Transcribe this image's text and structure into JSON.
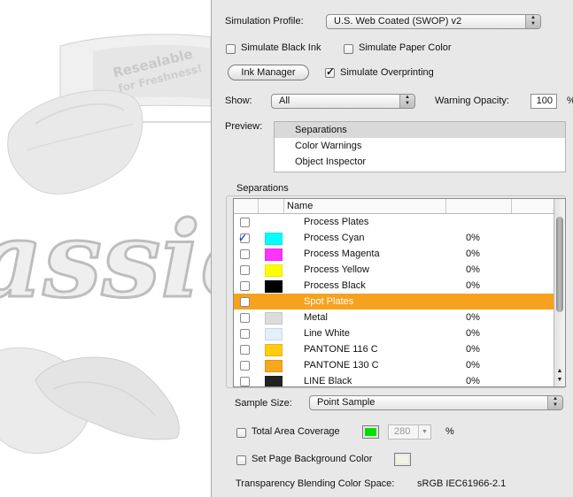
{
  "artwork": {
    "logo_text": "assic",
    "banner_text_line1": "Resealable",
    "banner_text_line2": "for Freshness!"
  },
  "panel": {
    "simulation_profile": {
      "label": "Simulation Profile:",
      "value": "U.S. Web Coated (SWOP) v2"
    },
    "simulate_black_ink": {
      "label": "Simulate Black Ink",
      "checked": false
    },
    "simulate_paper_color": {
      "label": "Simulate Paper Color",
      "checked": false
    },
    "ink_manager_label": "Ink Manager",
    "simulate_overprinting": {
      "label": "Simulate Overprinting",
      "checked": true
    },
    "show": {
      "label": "Show:",
      "value": "All"
    },
    "warning_opacity": {
      "label": "Warning Opacity:",
      "value": "100",
      "unit": "%"
    },
    "preview": {
      "label": "Preview:",
      "items": [
        "Separations",
        "Color Warnings",
        "Object Inspector"
      ],
      "selected": "Separations"
    },
    "separations": {
      "label": "Separations",
      "header_name": "Name",
      "rows": [
        {
          "name": "Process Plates",
          "pct": "",
          "checked": false,
          "swatch": "",
          "selected": false
        },
        {
          "name": "Process Cyan",
          "pct": "0%",
          "checked": true,
          "swatch": "#00ffff",
          "selected": false
        },
        {
          "name": "Process Magenta",
          "pct": "0%",
          "checked": false,
          "swatch": "#ff33ff",
          "selected": false
        },
        {
          "name": "Process Yellow",
          "pct": "0%",
          "checked": false,
          "swatch": "#ffff00",
          "selected": false
        },
        {
          "name": "Process Black",
          "pct": "0%",
          "checked": false,
          "swatch": "#000000",
          "selected": false
        },
        {
          "name": "Spot Plates",
          "pct": "",
          "checked": false,
          "swatch": "",
          "selected": true
        },
        {
          "name": "Metal",
          "pct": "0%",
          "checked": false,
          "swatch": "#dcdcdc",
          "selected": false
        },
        {
          "name": "Line White",
          "pct": "0%",
          "checked": false,
          "swatch": "#e3f0f9",
          "selected": false
        },
        {
          "name": "PANTONE 116 C",
          "pct": "0%",
          "checked": false,
          "swatch": "#ffcc11",
          "selected": false
        },
        {
          "name": "PANTONE 130 C",
          "pct": "0%",
          "checked": false,
          "swatch": "#f8a81a",
          "selected": false
        },
        {
          "name": "LINE Black",
          "pct": "0%",
          "checked": false,
          "swatch": "#222222",
          "selected": false
        }
      ]
    },
    "sample_size": {
      "label": "Sample Size:",
      "value": "Point Sample"
    },
    "total_area_coverage": {
      "label": "Total Area Coverage",
      "checked": false,
      "color": "#00dd00",
      "value": "280",
      "unit": "%"
    },
    "page_background": {
      "label": "Set Page Background Color",
      "checked": false,
      "color": "#f2f2e2"
    },
    "blending_space": {
      "label": "Transparency Blending Color Space:",
      "value": "sRGB IEC61966-2.1"
    }
  }
}
